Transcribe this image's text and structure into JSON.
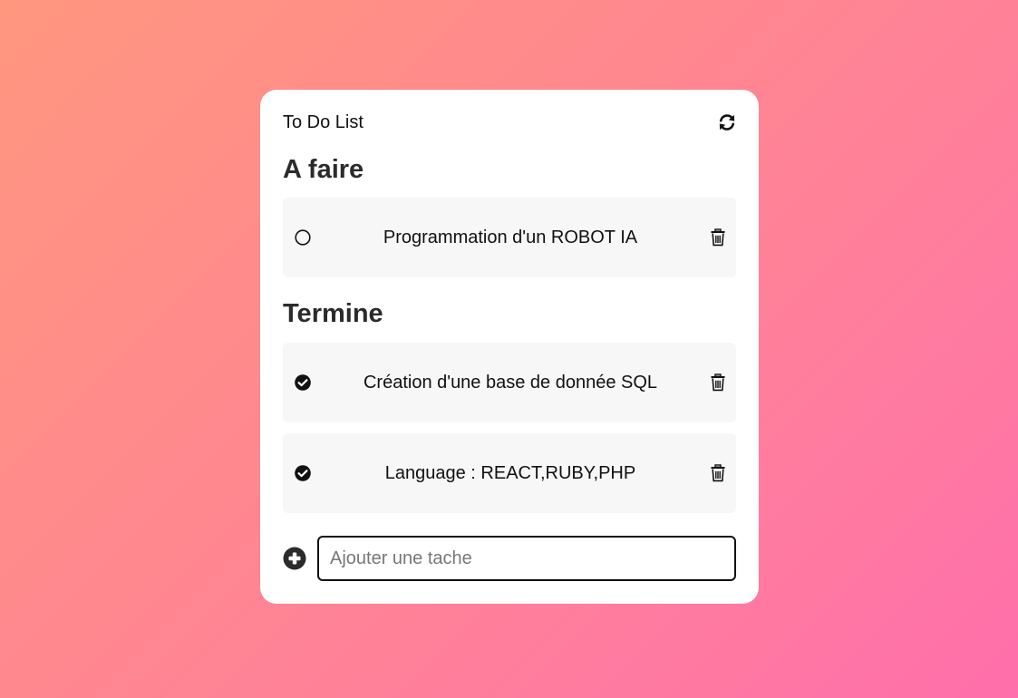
{
  "app": {
    "title": "To Do List",
    "refresh_icon": "refresh-icon"
  },
  "sections": {
    "todo_title": "A faire",
    "done_title": "Termine"
  },
  "todo_items": [
    {
      "label": "Programmation d'un ROBOT IA",
      "done": false
    }
  ],
  "done_items": [
    {
      "label": "Création d'une base de donnée SQL",
      "done": true
    },
    {
      "label": "Language : REACT,RUBY,PHP",
      "done": true
    }
  ],
  "add_task": {
    "placeholder": "Ajouter une tache",
    "value": "",
    "icon": "plus-circle-icon"
  },
  "colors": {
    "gradient_start": "#ff977f",
    "gradient_end": "#ff6fab",
    "card_bg": "#ffffff",
    "item_bg": "#f7f7f7",
    "text": "#111111"
  }
}
